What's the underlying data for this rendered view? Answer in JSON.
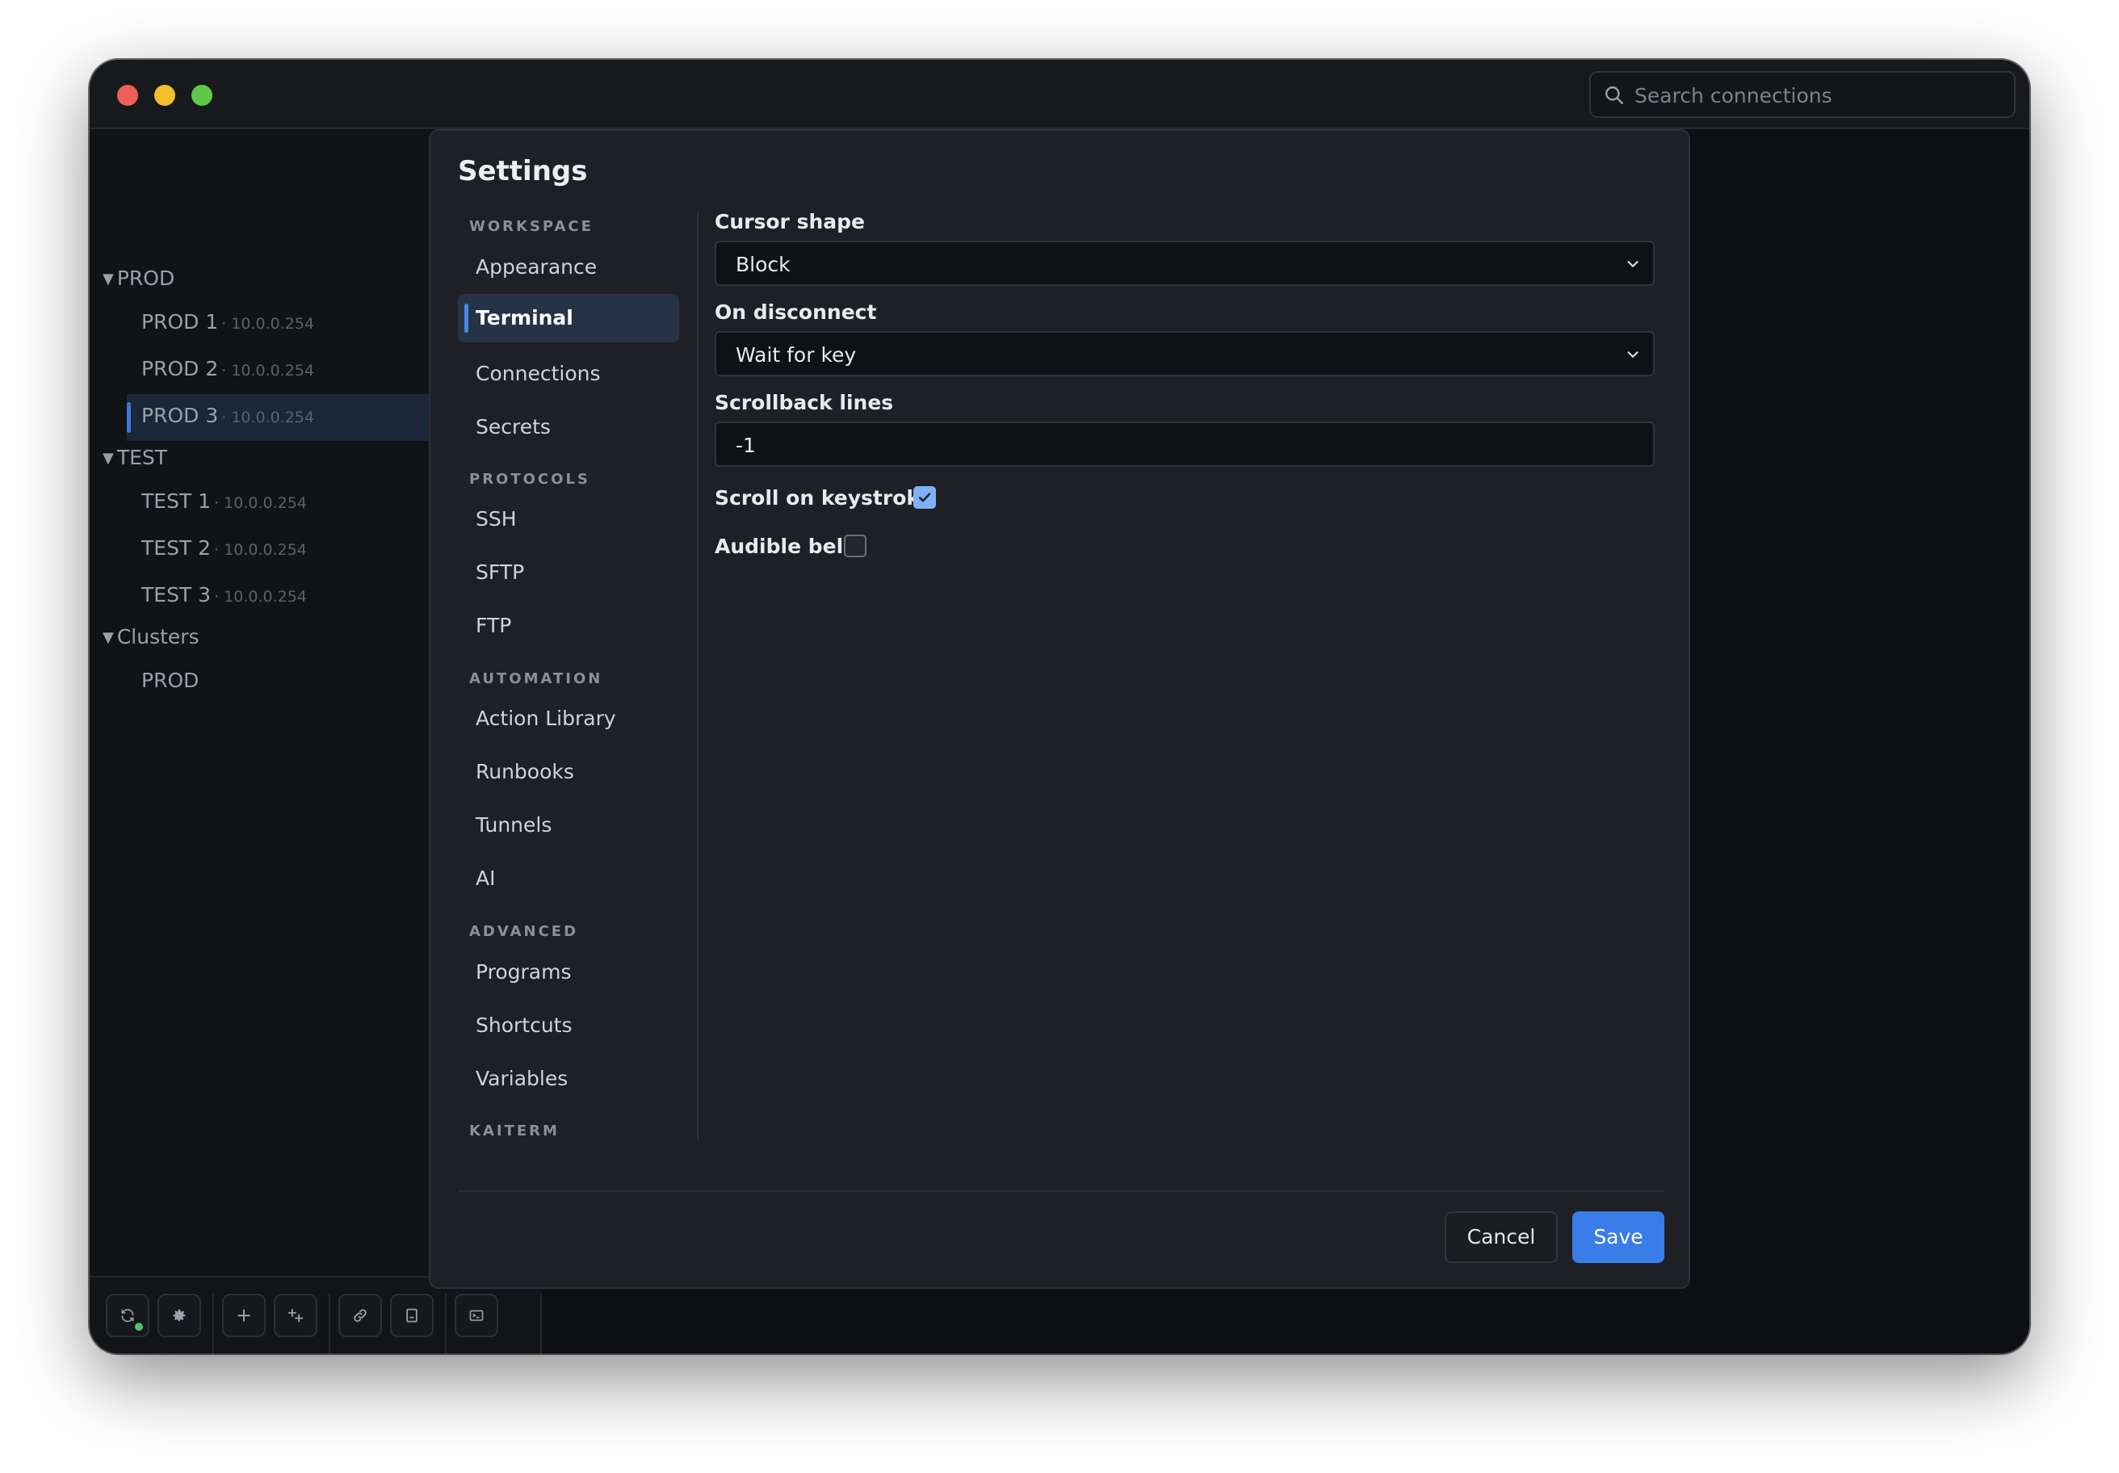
{
  "window": {
    "traffic_lights": [
      "close",
      "minimize",
      "zoom"
    ]
  },
  "search": {
    "placeholder": "Search connections",
    "icon": "search-icon"
  },
  "sidebar": {
    "groups": [
      {
        "label": "PROD",
        "items": [
          {
            "name": "PROD 1",
            "ip": "· 10.0.0.254"
          },
          {
            "name": "PROD 2",
            "ip": "· 10.0.0.254"
          },
          {
            "name": "PROD 3",
            "ip": "· 10.0.0.254",
            "selected": true
          }
        ]
      },
      {
        "label": "TEST",
        "items": [
          {
            "name": "TEST 1",
            "ip": "· 10.0.0.254"
          },
          {
            "name": "TEST 2",
            "ip": "· 10.0.0.254"
          },
          {
            "name": "TEST 3",
            "ip": "· 10.0.0.254"
          }
        ]
      },
      {
        "label": "Clusters",
        "items": [
          {
            "name": "PROD"
          }
        ]
      }
    ]
  },
  "toolbar": {
    "buttons": [
      "sync-icon",
      "gear-icon",
      "plus-icon",
      "add-group-icon",
      "link-icon",
      "bookmark-icon",
      "terminal-icon"
    ],
    "status_color": "#4ec36b"
  },
  "settings": {
    "title": "Settings",
    "nav": {
      "workspace": {
        "header": "WORKSPACE",
        "items": [
          "Appearance",
          "Terminal",
          "Connections",
          "Secrets"
        ]
      },
      "protocols": {
        "header": "PROTOCOLS",
        "items": [
          "SSH",
          "SFTP",
          "FTP"
        ]
      },
      "automation": {
        "header": "AUTOMATION",
        "items": [
          "Action Library",
          "Runbooks",
          "Tunnels",
          "AI"
        ]
      },
      "advanced": {
        "header": "ADVANCED",
        "items": [
          "Programs",
          "Shortcuts",
          "Variables"
        ]
      },
      "kaiterm": {
        "header": "KAITERM"
      }
    },
    "selected_nav": "Terminal",
    "fields": {
      "cursor_shape": {
        "label": "Cursor shape",
        "value": "Block"
      },
      "on_disconnect": {
        "label": "On disconnect",
        "value": "Wait for key"
      },
      "scrollback": {
        "label": "Scrollback lines",
        "value": "-1"
      },
      "scroll_on_keystroke": {
        "label": "Scroll on keystroke",
        "checked": true
      },
      "audible_bell": {
        "label": "Audible bell",
        "checked": false
      }
    },
    "actions": {
      "cancel": "Cancel",
      "save": "Save"
    },
    "accent_color": "#3a7ce8"
  }
}
